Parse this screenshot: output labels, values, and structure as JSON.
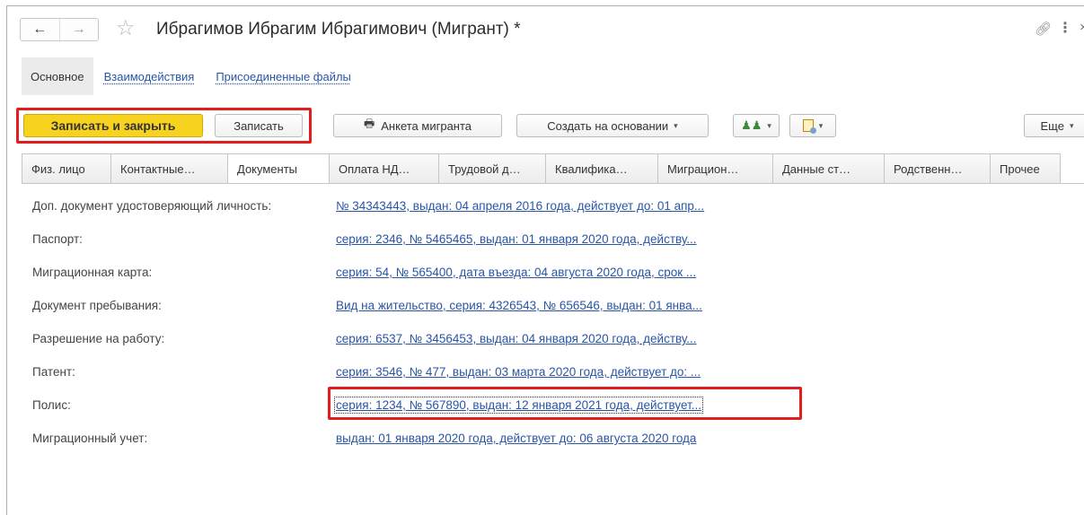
{
  "window": {
    "title": "Ибрагимов Ибрагим Ибрагимович (Мигрант) *",
    "back_icon": "←",
    "forward_icon": "→",
    "star_icon": "☆",
    "link_icon": "🔗",
    "more_icon": "⋮",
    "close_icon": "×"
  },
  "sections": {
    "items": [
      {
        "label": "Основное"
      },
      {
        "label": "Взаимодействия"
      },
      {
        "label": "Присоединенные файлы"
      }
    ]
  },
  "toolbar": {
    "save_close_label": "Записать и закрыть",
    "save_label": "Записать",
    "anketa_icon": "🖶",
    "anketa_label": "Анкета мигранта",
    "create_based_label": "Создать на основании",
    "people_icon": "👥",
    "more_label": "Еще",
    "caret": "▾"
  },
  "tabs": [
    {
      "label": "Физ. лицо"
    },
    {
      "label": "Контактные…"
    },
    {
      "label": "Документы"
    },
    {
      "label": "Оплата НД…"
    },
    {
      "label": "Трудовой д…"
    },
    {
      "label": "Квалифика…"
    },
    {
      "label": "Миграцион…"
    },
    {
      "label": "Данные ст…"
    },
    {
      "label": "Родственн…"
    },
    {
      "label": "Прочее"
    }
  ],
  "fields": [
    {
      "label": "Доп. документ удостоверяющий личность:",
      "value": "№ 34343443, выдан: 04 апреля 2016 года, действует до: 01 апр..."
    },
    {
      "label": "Паспорт:",
      "value": "серия: 2346, № 5465465, выдан: 01 января 2020 года, действу..."
    },
    {
      "label": "Миграционная карта:",
      "value": "серия: 54, № 565400, дата въезда: 04 августа 2020 года, срок ..."
    },
    {
      "label": "Документ пребывания:",
      "value": "Вид на жительство, серия: 4326543, № 656546, выдан: 01 янва..."
    },
    {
      "label": "Разрешение на работу:",
      "value": "серия: 6537, № 3456453, выдан: 04 января 2020 года, действу..."
    },
    {
      "label": "Патент:",
      "value": "серия: 3546, № 477, выдан: 03 марта 2020 года, действует до: ..."
    },
    {
      "label": "Полис:",
      "value": "серия: 1234, № 567890, выдан: 12 января 2021 года, действует..."
    },
    {
      "label": "Миграционный учет:",
      "value": "выдан: 01 января 2020 года, действует до: 06 августа 2020 года"
    }
  ],
  "colors": {
    "accent_button": "#f7d21e",
    "highlight": "#e21d1d",
    "link": "#2a55a6"
  }
}
